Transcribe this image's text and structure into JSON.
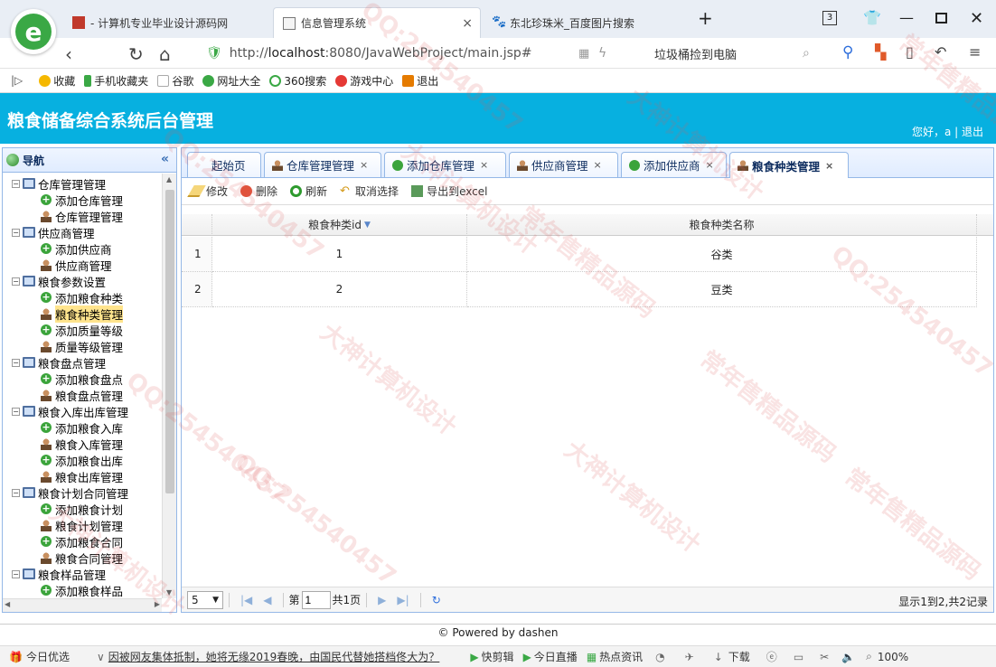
{
  "browser": {
    "tabs": [
      {
        "label": "- 计算机专业毕业设计源码网"
      },
      {
        "label": "信息管理系统",
        "close": "×"
      },
      {
        "label": "东北珍珠米_百度图片搜索"
      }
    ],
    "new_tab": "+",
    "tab_count": "3",
    "address": {
      "prefix": "http://",
      "host": "localhost",
      "rest": ":8080/JavaWebProject/main.jsp#"
    },
    "search_text": "垃圾桶捡到电脑",
    "bookmarks": [
      {
        "label": "收藏",
        "color": "#f5b800"
      },
      {
        "label": "手机收藏夹",
        "color": "#3aa845"
      },
      {
        "label": "谷歌",
        "color": "#bbbbbb"
      },
      {
        "label": "网址大全",
        "color": "#3aa845"
      },
      {
        "label": "360搜索",
        "color": "#3aa845"
      },
      {
        "label": "游戏中心",
        "color": "#e53935"
      },
      {
        "label": "退出",
        "color": "#e57b00"
      }
    ]
  },
  "app": {
    "title": "粮食储备综合系统后台管理",
    "user_info": "您好，a | 退出",
    "header_color": "#07b0e0"
  },
  "nav": {
    "title": "导航",
    "collapse": "«",
    "tree": [
      {
        "label": "仓库管理管理",
        "type": "group"
      },
      {
        "label": "添加仓库管理",
        "type": "add"
      },
      {
        "label": "仓库管理管理",
        "type": "user"
      },
      {
        "label": "供应商管理",
        "type": "group"
      },
      {
        "label": "添加供应商",
        "type": "add"
      },
      {
        "label": "供应商管理",
        "type": "user"
      },
      {
        "label": "粮食参数设置",
        "type": "group"
      },
      {
        "label": "添加粮食种类",
        "type": "add"
      },
      {
        "label": "粮食种类管理",
        "type": "user",
        "selected": true
      },
      {
        "label": "添加质量等级",
        "type": "add"
      },
      {
        "label": "质量等级管理",
        "type": "user"
      },
      {
        "label": "粮食盘点管理",
        "type": "group"
      },
      {
        "label": "添加粮食盘点",
        "type": "add"
      },
      {
        "label": "粮食盘点管理",
        "type": "user"
      },
      {
        "label": "粮食入库出库管理",
        "type": "group"
      },
      {
        "label": "添加粮食入库",
        "type": "add"
      },
      {
        "label": "粮食入库管理",
        "type": "user"
      },
      {
        "label": "添加粮食出库",
        "type": "add"
      },
      {
        "label": "粮食出库管理",
        "type": "user"
      },
      {
        "label": "粮食计划合同管理",
        "type": "group"
      },
      {
        "label": "添加粮食计划",
        "type": "add"
      },
      {
        "label": "粮食计划管理",
        "type": "user"
      },
      {
        "label": "添加粮食合同",
        "type": "add"
      },
      {
        "label": "粮食合同管理",
        "type": "user"
      },
      {
        "label": "粮食样品管理",
        "type": "group"
      },
      {
        "label": "添加粮食样品",
        "type": "add"
      }
    ]
  },
  "main": {
    "tabs": [
      {
        "label": "起始页",
        "icon": "none"
      },
      {
        "label": "仓库管理管理",
        "icon": "user",
        "close": "×"
      },
      {
        "label": "添加仓库管理",
        "icon": "add",
        "close": "×"
      },
      {
        "label": "供应商管理",
        "icon": "user",
        "close": "×"
      },
      {
        "label": "添加供应商",
        "icon": "add",
        "close": "×"
      },
      {
        "label": "粮食种类管理",
        "icon": "user",
        "close": "×",
        "active": true
      }
    ],
    "toolbar": [
      {
        "label": "修改",
        "icon": "pencil-icon"
      },
      {
        "label": "删除",
        "icon": "delete-icon"
      },
      {
        "label": "刷新",
        "icon": "refresh-icon"
      },
      {
        "label": "取消选择",
        "icon": "undo-icon"
      },
      {
        "label": "导出到excel",
        "icon": "export-icon"
      }
    ],
    "grid": {
      "columns": [
        "粮食种类id",
        "粮食种类名称"
      ],
      "sort_indicator": "▼",
      "rows": [
        {
          "num": "1",
          "id": "1",
          "name": "谷类"
        },
        {
          "num": "2",
          "id": "2",
          "name": "豆类"
        }
      ]
    },
    "pager": {
      "page_size": "5",
      "page_label_pre": "第",
      "page_value": "1",
      "page_label_post": "共1页",
      "info": "显示1到2,共2记录"
    }
  },
  "footer": "© Powered by dashen",
  "statusbar": [
    {
      "label": "今日优选"
    },
    {
      "label": "因被网友集体抵制，她将无缘2019春晚，由国民代替她搭档佟大为？"
    },
    {
      "label": "快剪辑"
    },
    {
      "label": "今日直播"
    },
    {
      "label": "热点资讯"
    },
    {
      "label": "下载"
    },
    {
      "label": "100%"
    }
  ],
  "watermark": [
    "QQ:254540457",
    "大神计算机设计",
    "常年售精品源码"
  ]
}
